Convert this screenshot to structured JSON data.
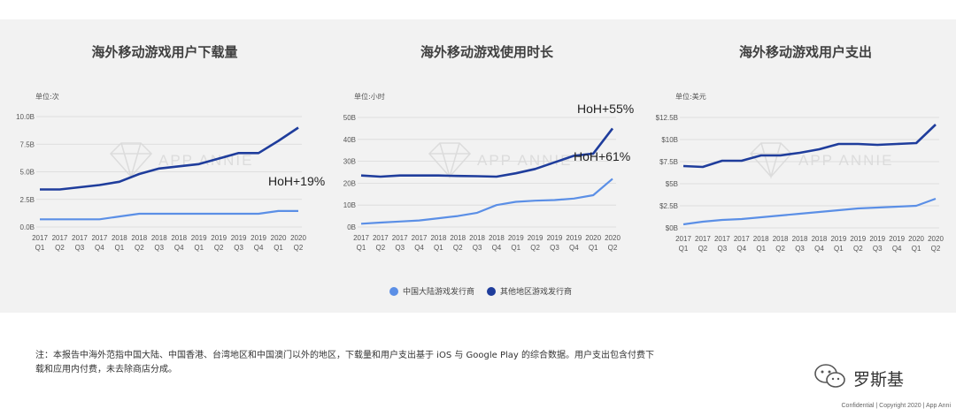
{
  "colors": {
    "china": "#5b8fe6",
    "other": "#1f3d9c",
    "panel": "#f2f2f2",
    "grid": "#d9d9d9"
  },
  "watermark": "APP ANNIE",
  "legend": {
    "china": "中国大陆游戏发行商",
    "other": "其他地区游戏发行商"
  },
  "note": "注：本报告中海外范指中国大陆、中国香港、台湾地区和中国澳门以外的地区，下载量和用户支出基于 iOS 与 Google Play 的综合数据。用户支出包含付费下载和应用内付费，未去除商店分成。",
  "brand": {
    "name": "罗斯基",
    "icon": "wechat-icon"
  },
  "footer": "Confidential  |  Copyright 2020  |  App Anni",
  "chart_data": [
    {
      "type": "line",
      "title": "海外移动游戏用户下载量",
      "unit_label": "单位:次",
      "categories": [
        [
          "2017",
          "Q1"
        ],
        [
          "2017",
          "Q2"
        ],
        [
          "2017",
          "Q3"
        ],
        [
          "2017",
          "Q4"
        ],
        [
          "2018",
          "Q1"
        ],
        [
          "2018",
          "Q2"
        ],
        [
          "2018",
          "Q3"
        ],
        [
          "2018",
          "Q4"
        ],
        [
          "2019",
          "Q1"
        ],
        [
          "2019",
          "Q2"
        ],
        [
          "2019",
          "Q3"
        ],
        [
          "2019",
          "Q4"
        ],
        [
          "2020",
          "Q1"
        ],
        [
          "2020",
          "Q2"
        ]
      ],
      "yticks": [
        0,
        2.5,
        5,
        7.5,
        10
      ],
      "ytick_labels": [
        "0.0B",
        "2.5B",
        "5.0B",
        "7.5B",
        "10.0B"
      ],
      "ylim": [
        0,
        10
      ],
      "grid": true,
      "series": [
        {
          "name": "中国大陆游戏发行商",
          "key": "china",
          "values": [
            0.7,
            0.7,
            0.7,
            0.7,
            0.95,
            1.2,
            1.2,
            1.2,
            1.2,
            1.2,
            1.2,
            1.2,
            1.45,
            1.45
          ]
        },
        {
          "name": "其他地区游戏发行商",
          "key": "other",
          "values": [
            3.4,
            3.4,
            3.6,
            3.8,
            4.1,
            4.8,
            5.3,
            5.5,
            5.7,
            6.2,
            6.7,
            6.7,
            7.8,
            9.0
          ]
        }
      ],
      "annotations": [
        {
          "text": "HoH+19%",
          "series": "china"
        }
      ]
    },
    {
      "type": "line",
      "title": "海外移动游戏使用时长",
      "unit_label": "单位:小时",
      "categories": [
        [
          "2017",
          "Q1"
        ],
        [
          "2017",
          "Q2"
        ],
        [
          "2017",
          "Q3"
        ],
        [
          "2017",
          "Q4"
        ],
        [
          "2018",
          "Q1"
        ],
        [
          "2018",
          "Q2"
        ],
        [
          "2018",
          "Q3"
        ],
        [
          "2018",
          "Q4"
        ],
        [
          "2019",
          "Q1"
        ],
        [
          "2019",
          "Q2"
        ],
        [
          "2019",
          "Q3"
        ],
        [
          "2019",
          "Q4"
        ],
        [
          "2020",
          "Q1"
        ],
        [
          "2020",
          "Q2"
        ]
      ],
      "yticks": [
        0,
        10,
        20,
        30,
        40,
        50
      ],
      "ytick_labels": [
        "0B",
        "10B",
        "20B",
        "30B",
        "40B",
        "50B"
      ],
      "ylim": [
        0,
        50
      ],
      "grid": true,
      "series": [
        {
          "name": "中国大陆游戏发行商",
          "key": "china",
          "values": [
            1.5,
            2.0,
            2.5,
            3.0,
            4.0,
            5.0,
            6.5,
            10.0,
            11.5,
            12.0,
            12.3,
            13.0,
            14.5,
            22.0
          ]
        },
        {
          "name": "其他地区游戏发行商",
          "key": "other",
          "values": [
            23.5,
            23.0,
            23.5,
            23.5,
            23.5,
            23.3,
            23.2,
            23.0,
            24.5,
            26.5,
            29.5,
            32.5,
            33.5,
            45.0
          ]
        }
      ],
      "annotations": [
        {
          "text": "HoH+55%",
          "series": "other"
        },
        {
          "text": "HoH+61%",
          "series": "china"
        }
      ]
    },
    {
      "type": "line",
      "title": "海外移动游戏用户支出",
      "unit_label": "单位:美元",
      "categories": [
        [
          "2017",
          "Q1"
        ],
        [
          "2017",
          "Q2"
        ],
        [
          "2017",
          "Q3"
        ],
        [
          "2017",
          "Q4"
        ],
        [
          "2018",
          "Q1"
        ],
        [
          "2018",
          "Q2"
        ],
        [
          "2018",
          "Q3"
        ],
        [
          "2018",
          "Q4"
        ],
        [
          "2019",
          "Q1"
        ],
        [
          "2019",
          "Q2"
        ],
        [
          "2019",
          "Q3"
        ],
        [
          "2019",
          "Q4"
        ],
        [
          "2020",
          "Q1"
        ],
        [
          "2020",
          "Q2"
        ]
      ],
      "yticks": [
        0,
        2.5,
        5,
        7.5,
        10,
        12.5
      ],
      "ytick_labels": [
        "$0B",
        "$2.5B",
        "$5B",
        "$7.5B",
        "$10B",
        "$12.5B"
      ],
      "ylim": [
        0,
        12.5
      ],
      "grid": true,
      "series": [
        {
          "name": "中国大陆游戏发行商",
          "key": "china",
          "values": [
            0.4,
            0.7,
            0.9,
            1.0,
            1.2,
            1.4,
            1.6,
            1.8,
            2.0,
            2.2,
            2.3,
            2.4,
            2.5,
            3.3
          ]
        },
        {
          "name": "其他地区游戏发行商",
          "key": "other",
          "values": [
            7.0,
            6.9,
            7.6,
            7.6,
            8.2,
            8.2,
            8.5,
            8.9,
            9.5,
            9.5,
            9.4,
            9.5,
            9.6,
            11.7
          ]
        }
      ]
    }
  ]
}
